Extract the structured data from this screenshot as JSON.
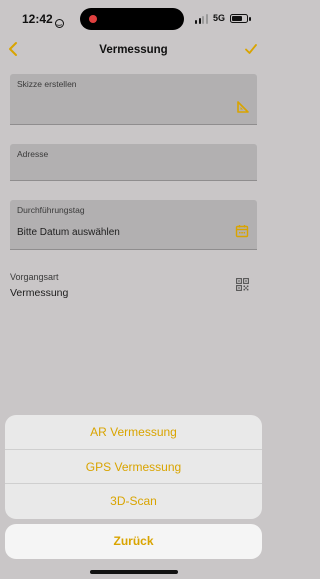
{
  "status_bar": {
    "time": "12:42",
    "network": "5G",
    "battery_level": 0.75,
    "recording_color": "#e0403f"
  },
  "nav": {
    "title": "Vermessung",
    "back_icon": "chevron-left-icon",
    "done_icon": "checkmark-icon",
    "accent_color": "#d9a400"
  },
  "form": {
    "sketch": {
      "label": "Skizze erstellen",
      "icon": "set-square-icon"
    },
    "address": {
      "label": "Adresse",
      "value": ""
    },
    "date": {
      "label": "Durchführungstag",
      "placeholder": "Bitte Datum auswählen",
      "icon": "calendar-icon"
    },
    "process_type": {
      "label": "Vorgangsart",
      "value": "Vermessung",
      "icon": "qr-code-icon"
    }
  },
  "action_sheet": {
    "options": [
      {
        "label": "AR Vermessung"
      },
      {
        "label": "GPS Vermessung"
      },
      {
        "label": "3D-Scan"
      }
    ],
    "cancel_label": "Zurück"
  }
}
